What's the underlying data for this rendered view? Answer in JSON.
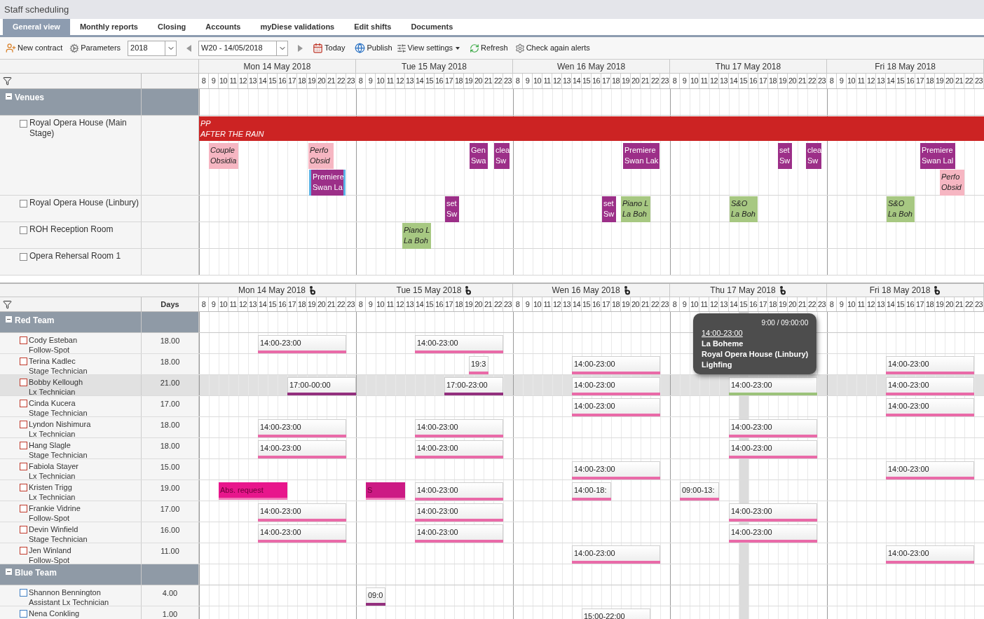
{
  "title": "Staff scheduling",
  "tabs": [
    {
      "label": "General view",
      "selected": true
    },
    {
      "label": "Monthly reports",
      "selected": false
    },
    {
      "label": "Closing",
      "selected": false
    },
    {
      "label": "Accounts",
      "selected": false
    },
    {
      "label": "myDiese validations",
      "selected": false
    },
    {
      "label": "Edit shifts",
      "selected": false
    },
    {
      "label": "Documents",
      "selected": false
    }
  ],
  "toolbar": {
    "new_contract": "New contract",
    "parameters": "Parameters",
    "year": "2018",
    "week": "W20 - 14/05/2018",
    "today": "Today",
    "publish": "Publish",
    "view_settings": "View settings",
    "refresh": "Refresh",
    "check_alerts": "Check again alerts"
  },
  "venue_schedule": {
    "days": [
      {
        "label": "Mon 14 May 2018",
        "hours": [
          "8",
          "9",
          "10",
          "11",
          "12",
          "13",
          "14",
          "15",
          "16",
          "17",
          "18",
          "19",
          "20",
          "21",
          "22",
          "23"
        ]
      },
      {
        "label": "Tue 15 May 2018",
        "hours": [
          "8",
          "9",
          "10",
          "11",
          "12",
          "13",
          "14",
          "15",
          "16",
          "17",
          "18",
          "19",
          "20",
          "21",
          "22",
          "23"
        ]
      },
      {
        "label": "Wen 16 May 2018",
        "hours": [
          "8",
          "9",
          "10",
          "11",
          "12",
          "13",
          "14",
          "15",
          "16",
          "17",
          "18",
          "19",
          "20",
          "21",
          "22",
          "23"
        ]
      },
      {
        "label": "Thu 17 May 2018",
        "hours": [
          "8",
          "9",
          "10",
          "11",
          "12",
          "13",
          "14",
          "15",
          "16",
          "17",
          "18",
          "19",
          "20",
          "21",
          "22",
          "23"
        ]
      },
      {
        "label": "Fri 18 May 2018",
        "hours": [
          "8",
          "9",
          "10",
          "11",
          "12",
          "13",
          "14",
          "15",
          "16",
          "17",
          "18",
          "19",
          "20",
          "21",
          "22",
          "23"
        ]
      }
    ],
    "group": {
      "label": "Venues",
      "expanded": true
    },
    "venues": [
      {
        "name": "Royal Opera House (Main Stage)",
        "checked": false,
        "blocks": [
          {
            "lines": [
              "PP",
              "AFTER THE RAIN"
            ],
            "kind": "band",
            "color": "#cc2323",
            "selected": false
          },
          {
            "lines": [
              "Couple",
              "Obsidia"
            ],
            "kind": "event",
            "color": "#f6b6c2",
            "selected": false
          },
          {
            "lines": [
              "Perfo",
              "Obsid"
            ],
            "kind": "event",
            "color": "#f6b6c2",
            "selected": false
          },
          {
            "lines": [
              "Premiere",
              "Swan La"
            ],
            "kind": "task",
            "color": "#9c2f88",
            "selected": true
          },
          {
            "lines": [
              "Gen",
              "Swa"
            ],
            "kind": "task",
            "color": "#9c2f88",
            "selected": false
          },
          {
            "lines": [
              "clea",
              "Sw"
            ],
            "kind": "task",
            "color": "#9c2f88",
            "selected": false
          },
          {
            "lines": [
              "Premiere",
              "Swan Lak"
            ],
            "kind": "task",
            "color": "#9c2f88",
            "selected": false
          },
          {
            "lines": [
              "set",
              "Sw"
            ],
            "kind": "task",
            "color": "#9c2f88",
            "selected": false
          },
          {
            "lines": [
              "clea",
              "Sw"
            ],
            "kind": "task",
            "color": "#9c2f88",
            "selected": false
          },
          {
            "lines": [
              "Premiere",
              "Swan Lal"
            ],
            "kind": "task",
            "color": "#9c2f88",
            "selected": false
          },
          {
            "lines": [
              "Perfo",
              "Obsid"
            ],
            "kind": "event",
            "color": "#f6b6c2",
            "selected": false
          }
        ]
      },
      {
        "name": "Royal Opera House (Linbury)",
        "checked": false,
        "blocks": [
          {
            "lines": [
              "set",
              "Sw"
            ],
            "kind": "task",
            "color": "#9c2f88",
            "selected": false
          },
          {
            "lines": [
              "set",
              "Sw"
            ],
            "kind": "task",
            "color": "#9c2f88",
            "selected": false
          },
          {
            "lines": [
              "Piano L",
              "La Boh"
            ],
            "kind": "event",
            "color": "#a7c882",
            "selected": false
          },
          {
            "lines": [
              "S&O",
              "La Boh"
            ],
            "kind": "event",
            "color": "#a7c882",
            "selected": false
          },
          {
            "lines": [
              "S&O",
              "La Boh"
            ],
            "kind": "event",
            "color": "#a7c882",
            "selected": false
          }
        ]
      },
      {
        "name": "ROH Reception Room",
        "checked": false,
        "blocks": [
          {
            "lines": [
              "Piano L",
              "La Boh"
            ],
            "kind": "event",
            "color": "#a7c882",
            "selected": false
          }
        ]
      },
      {
        "name": "Opera Rehersal Room 1",
        "checked": false
      }
    ]
  },
  "staff_schedule": {
    "days_heading": "Days",
    "days": [
      {
        "label": "Mon 14 May 2018",
        "hours": [
          "8",
          "9",
          "10",
          "11",
          "12",
          "13",
          "14",
          "15",
          "16",
          "17",
          "18",
          "19",
          "20",
          "21",
          "22",
          "23"
        ]
      },
      {
        "label": "Tue 15 May 2018",
        "hours": [
          "8",
          "9",
          "10",
          "11",
          "12",
          "13",
          "14",
          "15",
          "16",
          "17",
          "18",
          "19",
          "20",
          "21",
          "22",
          "23"
        ]
      },
      {
        "label": "Wen 16 May 2018",
        "hours": [
          "8",
          "9",
          "10",
          "11",
          "12",
          "13",
          "14",
          "15",
          "16",
          "17",
          "18",
          "19",
          "20",
          "21",
          "22",
          "23"
        ]
      },
      {
        "label": "Thu 17 May 2018",
        "hours": [
          "8",
          "9",
          "10",
          "11",
          "12",
          "13",
          "14",
          "15",
          "16",
          "17",
          "18",
          "19",
          "20",
          "21",
          "22",
          "23"
        ]
      },
      {
        "label": "Fri 18 May 2018",
        "hours": [
          "8",
          "9",
          "10",
          "11",
          "12",
          "13",
          "14",
          "15",
          "16",
          "17",
          "18",
          "19",
          "20",
          "21",
          "22",
          "23"
        ]
      }
    ],
    "teams": [
      {
        "label": "Red Team",
        "expanded": true,
        "color": "#c0392b",
        "members": [
          {
            "name": "Cody Esteban",
            "role": "Follow-Spot",
            "days": "18.00",
            "checked": false,
            "selected": false,
            "shifts": [
              {
                "kind": "shift",
                "time": "14:00-23:00",
                "color": "#e96aa8"
              },
              {
                "kind": "shift",
                "time": "14:00-23:00",
                "color": "#e96aa8"
              }
            ]
          },
          {
            "name": "Terina Kadlec",
            "role": "Stage Technician",
            "days": "18.00",
            "checked": false,
            "selected": false,
            "shifts": [
              {
                "kind": "shift",
                "time": "19:3",
                "color": "#e96aa8"
              },
              {
                "kind": "shift",
                "time": "14:00-23:00",
                "color": "#e96aa8"
              },
              {
                "kind": "shift",
                "time": "14:00-23:00",
                "color": "#e96aa8"
              }
            ]
          },
          {
            "name": "Bobby Kellough",
            "role": "Lx Technician",
            "days": "21.00",
            "checked": false,
            "selected": true,
            "shifts": [
              {
                "kind": "shift",
                "time": "17:00-00:00",
                "color": "#93307e"
              },
              {
                "kind": "shift",
                "time": "17:00-23:00",
                "color": "#93307e"
              },
              {
                "kind": "shift",
                "time": "14:00-23:00",
                "color": "#e96aa8"
              },
              {
                "kind": "shift",
                "time": "14:00-23:00",
                "color": "#9bc27a"
              },
              {
                "kind": "shift",
                "time": "14:00-23:00",
                "color": "#e96aa8"
              }
            ]
          },
          {
            "name": "Cinda Kucera",
            "role": "Stage Technician",
            "days": "17.00",
            "checked": false,
            "selected": false,
            "shifts": [
              {
                "kind": "shift",
                "time": "14:00-23:00",
                "color": "#e96aa8"
              },
              {
                "kind": "shift",
                "time": "14:00-23:00",
                "color": "#e96aa8"
              }
            ]
          },
          {
            "name": "Lyndon Nishimura",
            "role": "Lx Technician",
            "days": "18.00",
            "checked": false,
            "selected": false,
            "shifts": [
              {
                "kind": "shift",
                "time": "14:00-23:00",
                "color": "#e96aa8"
              },
              {
                "kind": "shift",
                "time": "14:00-23:00",
                "color": "#e96aa8"
              },
              {
                "kind": "shift",
                "time": "14:00-23:00",
                "color": "#e96aa8"
              }
            ]
          },
          {
            "name": "Hang Slagle",
            "role": "Stage Technician",
            "days": "18.00",
            "checked": false,
            "selected": false,
            "shifts": [
              {
                "kind": "shift",
                "time": "14:00-23:00",
                "color": "#e96aa8"
              },
              {
                "kind": "shift",
                "time": "14:00-23:00",
                "color": "#e96aa8"
              },
              {
                "kind": "shift",
                "time": "14:00-23:00",
                "color": "#e96aa8"
              }
            ]
          },
          {
            "name": "Fabiola Stayer",
            "role": "Lx Technician",
            "days": "15.00",
            "checked": false,
            "selected": false,
            "shifts": [
              {
                "kind": "shift",
                "time": "14:00-23:00",
                "color": "#e96aa8"
              },
              {
                "kind": "shift",
                "time": "14:00-23:00",
                "color": "#e96aa8"
              }
            ]
          },
          {
            "name": "Kristen Trigg",
            "role": "Lx Technician",
            "days": "19.00",
            "checked": false,
            "selected": false,
            "shifts": [
              {
                "kind": "absence",
                "time": "Abs. request",
                "color": "#e8168c"
              },
              {
                "kind": "absence",
                "time": "S",
                "color": "#cc1a84"
              },
              {
                "kind": "shift",
                "time": "14:00-23:00",
                "color": "#e96aa8"
              },
              {
                "kind": "shift",
                "time": "14:00-18:",
                "color": "#e96aa8"
              },
              {
                "kind": "shift",
                "time": "09:00-13:",
                "color": "#e96aa8"
              }
            ]
          },
          {
            "name": "Frankie Vidrine",
            "role": "Follow-Spot",
            "days": "17.00",
            "checked": false,
            "selected": false,
            "shifts": [
              {
                "kind": "shift",
                "time": "14:00-23:00",
                "color": "#e96aa8"
              },
              {
                "kind": "shift",
                "time": "14:00-23:00",
                "color": "#e96aa8"
              },
              {
                "kind": "shift",
                "time": "14:00-23:00",
                "color": "#e96aa8"
              }
            ]
          },
          {
            "name": "Devin Winfield",
            "role": "Stage Technician",
            "days": "16.00",
            "checked": false,
            "selected": false,
            "shifts": [
              {
                "kind": "shift",
                "time": "14:00-23:00",
                "color": "#e96aa8"
              },
              {
                "kind": "shift",
                "time": "14:00-23:00",
                "color": "#e96aa8"
              },
              {
                "kind": "shift",
                "time": "14:00-23:00",
                "color": "#e96aa8"
              }
            ]
          },
          {
            "name": "Jen Winland",
            "role": "Follow-Spot",
            "days": "11.00",
            "checked": false,
            "selected": false,
            "shifts": [
              {
                "kind": "shift",
                "time": "14:00-23:00",
                "color": "#e96aa8"
              },
              {
                "kind": "shift",
                "time": "14:00-23:00",
                "color": "#e96aa8"
              }
            ]
          }
        ]
      },
      {
        "label": "Blue Team",
        "expanded": true,
        "color": "#3f7fc4",
        "members": [
          {
            "name": "Shannon Bennington",
            "role": "Assistant Lx Technician",
            "days": "4.00",
            "checked": false,
            "selected": false,
            "shifts": [
              {
                "kind": "shift",
                "time": "09:0",
                "color": "#93307e"
              }
            ]
          },
          {
            "name": "Nena Conkling",
            "days": "1.00",
            "checked": false,
            "selected": false,
            "shifts": [
              {
                "kind": "shift",
                "time": "15:00-22:00"
              }
            ]
          }
        ]
      }
    ]
  },
  "tooltip": {
    "header": "9:00 / 09:00:00",
    "time": "14:00-23:00",
    "lines": [
      "La Boheme",
      "Royal Opera House (Linbury)",
      "Lighfing"
    ]
  }
}
